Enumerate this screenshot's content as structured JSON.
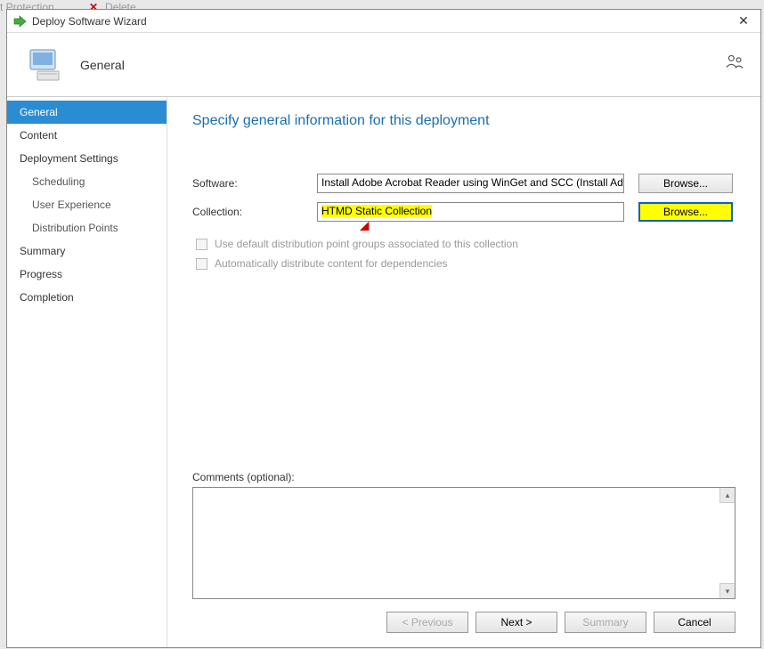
{
  "background": {
    "partial_text": "t Protection",
    "delete_label": "Delete"
  },
  "window": {
    "title": "Deploy Software Wizard"
  },
  "header": {
    "page_title": "General"
  },
  "sidebar": {
    "items": [
      {
        "label": "General",
        "selected": true
      },
      {
        "label": "Content"
      },
      {
        "label": "Deployment Settings"
      },
      {
        "label": "Scheduling",
        "indent": true
      },
      {
        "label": "User Experience",
        "indent": true
      },
      {
        "label": "Distribution Points",
        "indent": true
      },
      {
        "label": "Summary"
      },
      {
        "label": "Progress"
      },
      {
        "label": "Completion"
      }
    ]
  },
  "main": {
    "heading": "Specify general information for this deployment",
    "software_label": "Software:",
    "software_value": "Install Adobe Acrobat Reader using WinGet and SCC (Install Ado",
    "software_browse": "Browse...",
    "collection_label": "Collection:",
    "collection_value": "HTMD Static Collection",
    "collection_browse": "Browse...",
    "checkbox1_label": "Use default distribution point groups associated to this collection",
    "checkbox2_label": "Automatically distribute content for dependencies",
    "comments_label": "Comments (optional):"
  },
  "footer": {
    "previous": "< Previous",
    "next": "Next >",
    "summary": "Summary",
    "cancel": "Cancel"
  },
  "annotations": {
    "arrow1_target": "collection-field",
    "arrow2_target": "collection-browse-button",
    "highlight_color": "#ffff00",
    "arrow_color": "#d40000"
  }
}
